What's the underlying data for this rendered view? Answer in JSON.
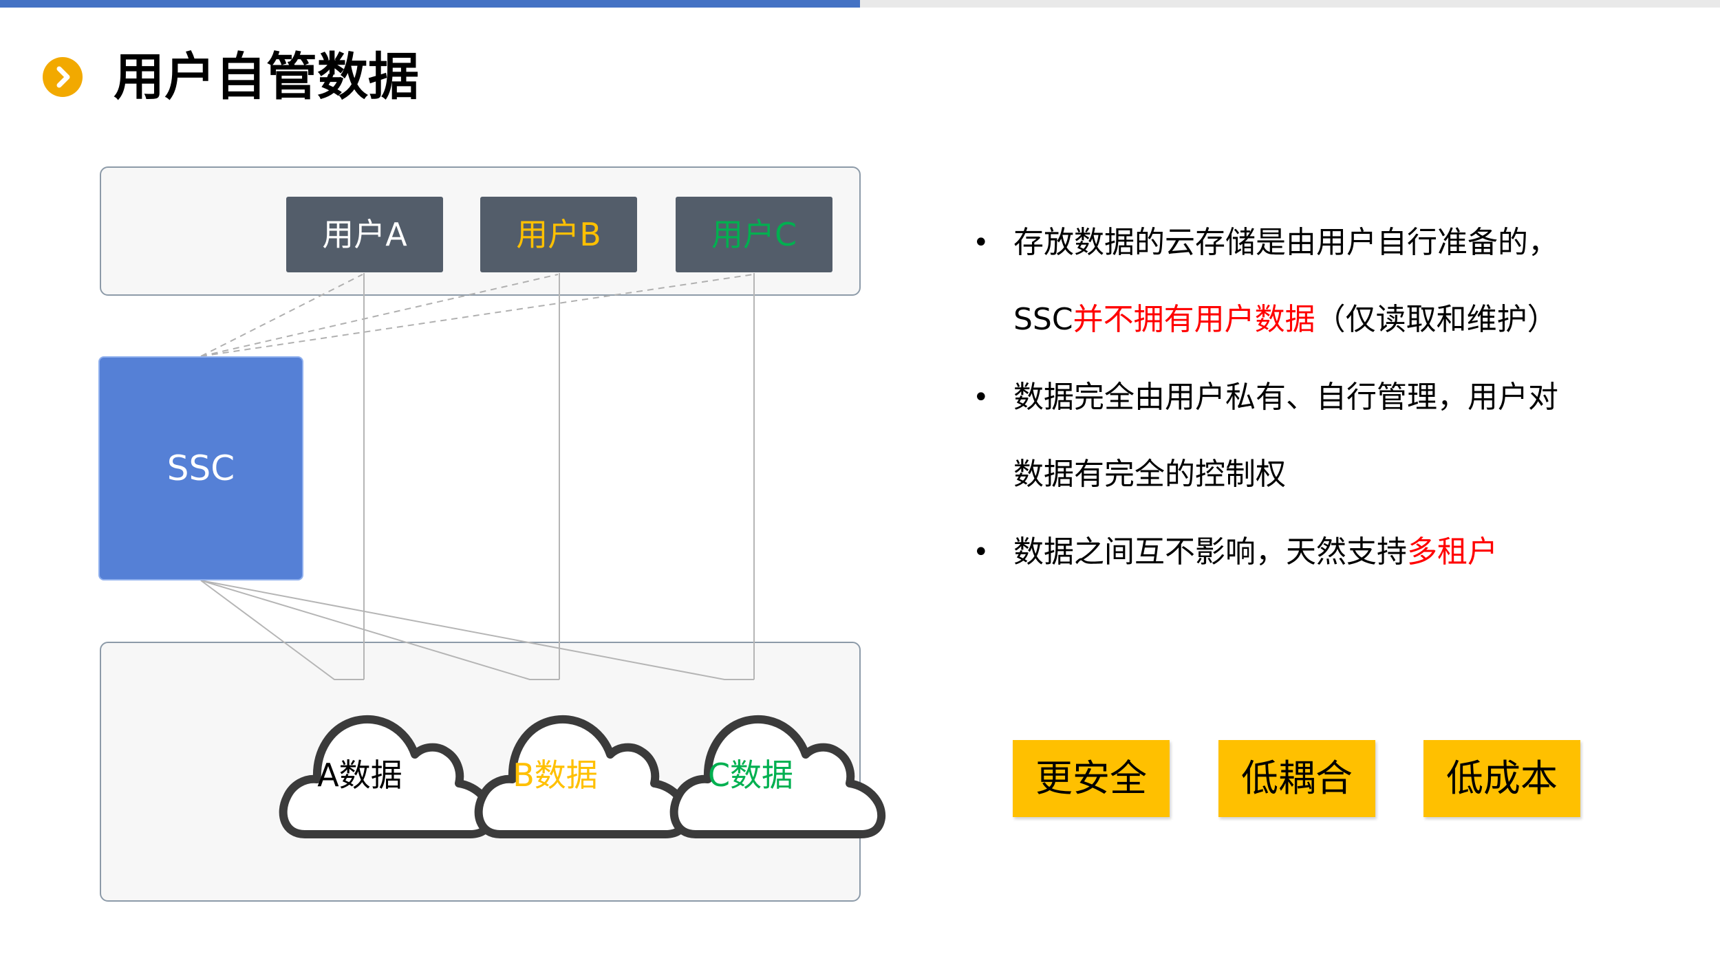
{
  "header": {
    "title": "用户自管数据",
    "icon": "chevron-right-icon",
    "accent_color": "#4472c4",
    "icon_color": "#f2a900"
  },
  "diagram": {
    "users": [
      {
        "label": "用户A",
        "color": "#ffffff"
      },
      {
        "label": "用户B",
        "color": "#ffc000"
      },
      {
        "label": "用户C",
        "color": "#00b050"
      }
    ],
    "ssc": {
      "label": "SSC",
      "color": "#5580d6"
    },
    "stores": [
      {
        "label": "A数据",
        "color": "#000000"
      },
      {
        "label": "B数据",
        "color": "#ffc000"
      },
      {
        "label": "C数据",
        "color": "#00b050"
      }
    ]
  },
  "bullets": [
    {
      "lines": [
        [
          {
            "text": "存放数据的云存储是由用户自行准备的，",
            "highlight": false
          }
        ],
        [
          {
            "text": "SSC",
            "highlight": false
          },
          {
            "text": "并不拥有用户数据",
            "highlight": true
          },
          {
            "text": "（仅读取和维护）",
            "highlight": false
          }
        ]
      ]
    },
    {
      "lines": [
        [
          {
            "text": "数据完全由用户私有、自行管理，用户对",
            "highlight": false
          }
        ],
        [
          {
            "text": "数据有完全的控制权",
            "highlight": false
          }
        ]
      ]
    },
    {
      "lines": [
        [
          {
            "text": "数据之间互不影响，天然支持",
            "highlight": false
          },
          {
            "text": "多租户",
            "highlight": true
          }
        ]
      ]
    }
  ],
  "tags": [
    "更安全",
    "低耦合",
    "低成本"
  ],
  "colors": {
    "highlight": "#ff0000",
    "tag_background": "#ffc000",
    "user_box": "#535d6a"
  }
}
